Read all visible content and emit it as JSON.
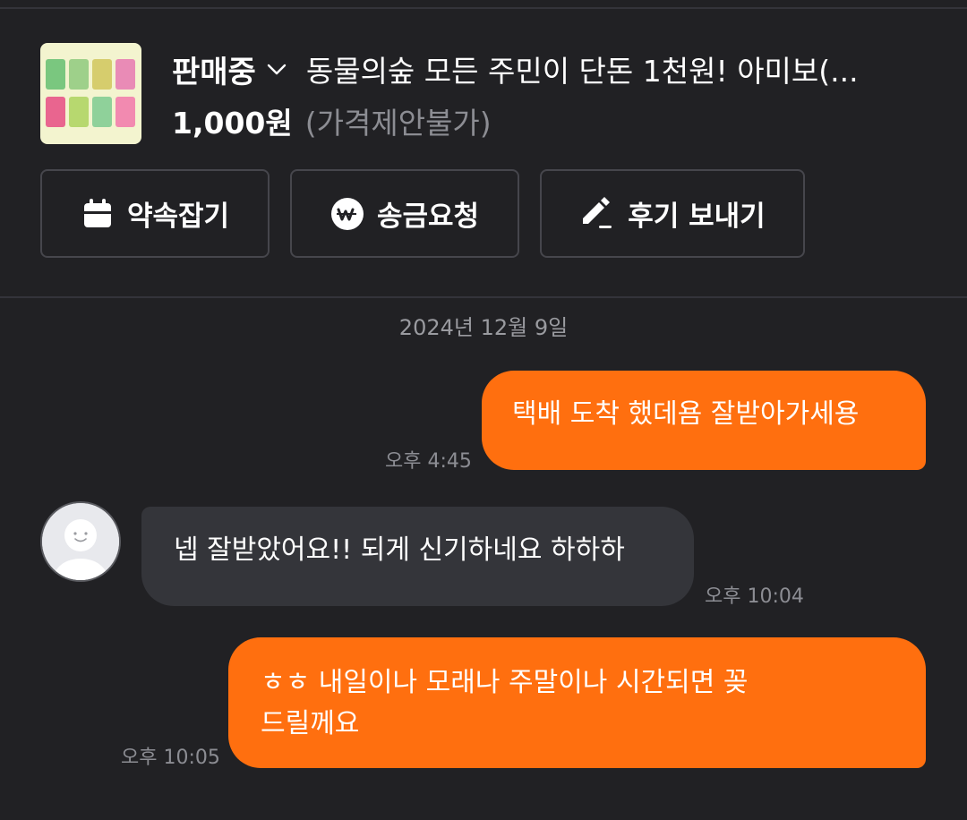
{
  "product": {
    "status": "판매중",
    "title": "동물의숲 모든 주민이 단돈 1천원! 아미보(...",
    "price": "1,000원",
    "price_note": "(가격제안불가)",
    "thumbnail_card_colors": [
      "#7ac77f",
      "#9ed08a",
      "#d6cd6d",
      "#e98bb6",
      "#e9658f",
      "#b7d86f",
      "#8fd19a",
      "#f28ab0"
    ]
  },
  "actions": [
    {
      "label": "약속잡기",
      "icon": "calendar-icon"
    },
    {
      "label": "송금요청",
      "icon": "won-coin-icon"
    },
    {
      "label": "후기 보내기",
      "icon": "pencil-icon"
    }
  ],
  "chat": {
    "date": "2024년 12월 9일",
    "messages": [
      {
        "sender": "me",
        "text": "택배 도착 했데욤 잘받아가세용",
        "time": "오후 4:45"
      },
      {
        "sender": "them",
        "text": "넵 잘받았어요!! 되게 신기하네요 하하하",
        "time": "오후 10:04"
      },
      {
        "sender": "me",
        "text_line1": "ㅎㅎ 내일이나 모래나 주말이나 시간되면 꽂",
        "text_line2": "드릴께요",
        "time": "오후 10:05"
      }
    ]
  },
  "colors": {
    "background": "#212124",
    "accent": "#ff6f0f",
    "incoming_bubble": "#34353a"
  }
}
